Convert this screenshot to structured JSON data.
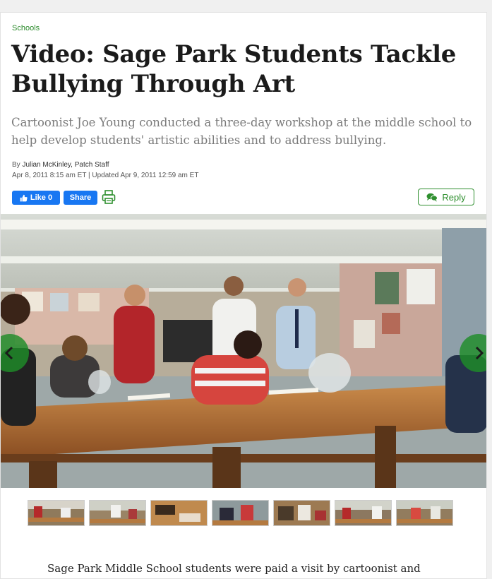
{
  "article": {
    "category": "Schools",
    "headline": "Video: Sage Park Students Tackle Bullying Through Art",
    "dek": "Cartoonist Joe Young conducted a three-day workshop at the middle school to help develop students' artistic abilities and to address bullying.",
    "byline_prefix": "By ",
    "author": "Julian McKinley, Patch Staff",
    "dateline": "Apr 8, 2011 8:15 am ET | Updated Apr 9, 2011 12:59 am ET",
    "body_first_line": "Sage Park Middle School students were paid a visit by cartoonist and"
  },
  "actions": {
    "like_label": "Like 0",
    "share_label": "Share",
    "reply_label": "Reply",
    "print_icon": "printer-icon"
  },
  "gallery": {
    "thumb_count": 7,
    "prev_icon": "chevron-left-icon",
    "next_icon": "chevron-right-icon"
  },
  "colors": {
    "accent_green": "#2f8f2f",
    "facebook_blue": "#1877f2",
    "headline": "#1b1b1b",
    "dek": "#7b7b7b"
  }
}
